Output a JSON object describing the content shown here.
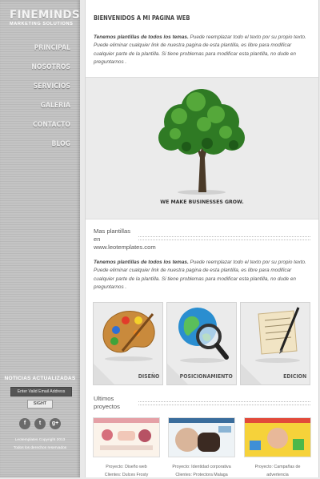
{
  "logo": {
    "main": "FINEMINDS",
    "sub": "MARKETING SOLUTIONS"
  },
  "nav": [
    {
      "label": "PRINCIPAL"
    },
    {
      "label": "NOSOTROS"
    },
    {
      "label": "SERVICIOS"
    },
    {
      "label": "GALERIA"
    },
    {
      "label": "CONTACTO"
    },
    {
      "label": "BLOG"
    }
  ],
  "newsletter": {
    "title": "NOTICIAS ACTUALIZADAS",
    "email_placeholder": "Enter Valid Email Address",
    "button": "SIGHT"
  },
  "social": [
    {
      "icon": "facebook-icon",
      "glyph": "f"
    },
    {
      "icon": "twitter-icon",
      "glyph": "t"
    },
    {
      "icon": "google-plus-icon",
      "glyph": "g+"
    }
  ],
  "copyright": [
    "Leotemplates Copyright 2013",
    "Todos los derechos reservados"
  ],
  "welcome": {
    "title": "BIENVENIDOS A MI PAGINA WEB",
    "lead": "Tenemos plantillas de todos los temas.",
    "body": " Puede reemplazar todo el texto por su propio texto. Puede eliminar cualquier link de nuestra pagina de esta plantilla, es libre para modificar cualquier parte de la plantilla. Si tiene problemas para modificar esta plantilla, no dude en preguntarnos ."
  },
  "tree": {
    "caption": "WE MAKE BUSINESSES GROW."
  },
  "more": {
    "title_lines": [
      "Mas plantillas",
      "en",
      "www.leotemplates.com"
    ],
    "lead": "Tenemos plantillas de todos los temas.",
    "body": " Puede reemplazar todo el texto por su propio texto. Puede eliminar cualquier link de nuestra pagina de esta plantilla, es libre para modificar cualquier parte de la plantilla. Si tiene problemas para modificar esta plantilla, no dude en preguntarnos ."
  },
  "services": [
    {
      "label": "DISEÑO"
    },
    {
      "label": "POSICIONAMIENTO"
    },
    {
      "label": "EDICION"
    }
  ],
  "projects": {
    "title_lines": [
      "Ultimos",
      "proyectos"
    ],
    "items": [
      {
        "line1": "Proyecto: Diseño web",
        "line2": "Clientes: Dulces Frosty"
      },
      {
        "line1": "Proyecto: Identidad corporativa",
        "line2": "Clientes: Protectora Malaga"
      },
      {
        "line1": "Proyecto: Campañas de",
        "line2": "advertencia"
      }
    ]
  },
  "colors": {
    "sidebar": "#c0c0c0",
    "panel": "#ebebeb",
    "text": "#555555"
  }
}
